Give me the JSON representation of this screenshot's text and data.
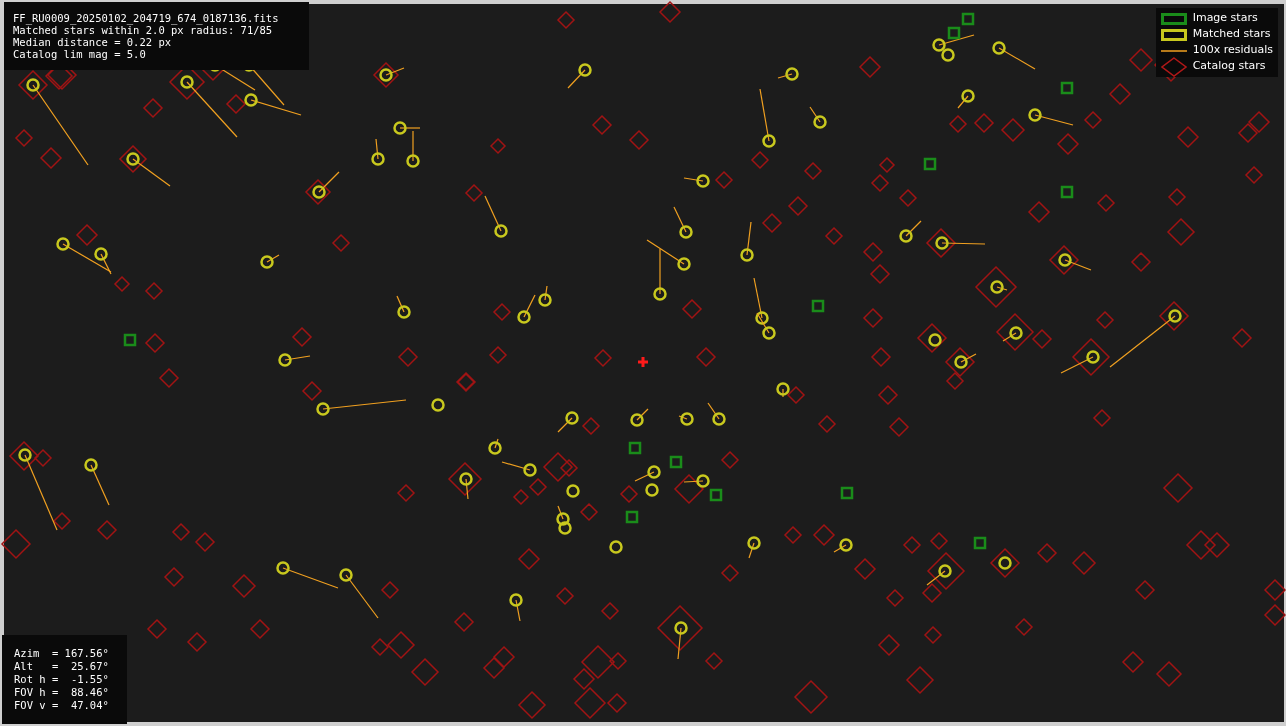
{
  "info_box": {
    "lines": [
      "FF_RU0009_20250102_204719_674_0187136.fits",
      "Matched stars within 2.0 px radius: 71/85",
      "Median distance = 0.22 px",
      "Catalog lim mag = 5.0"
    ]
  },
  "legend": [
    {
      "kind": "image",
      "label": "Image stars"
    },
    {
      "kind": "matched",
      "label": "Matched stars"
    },
    {
      "kind": "residual",
      "label": "100x residuals"
    },
    {
      "kind": "catalog",
      "label": "Catalog stars"
    }
  ],
  "pointing_box": {
    "lines": [
      "Azim  = 167.56°",
      "Alt   =  25.67°",
      "Rot h =  -1.55°",
      "FOV h =  88.46°",
      "FOV v =  47.04°"
    ]
  }
}
